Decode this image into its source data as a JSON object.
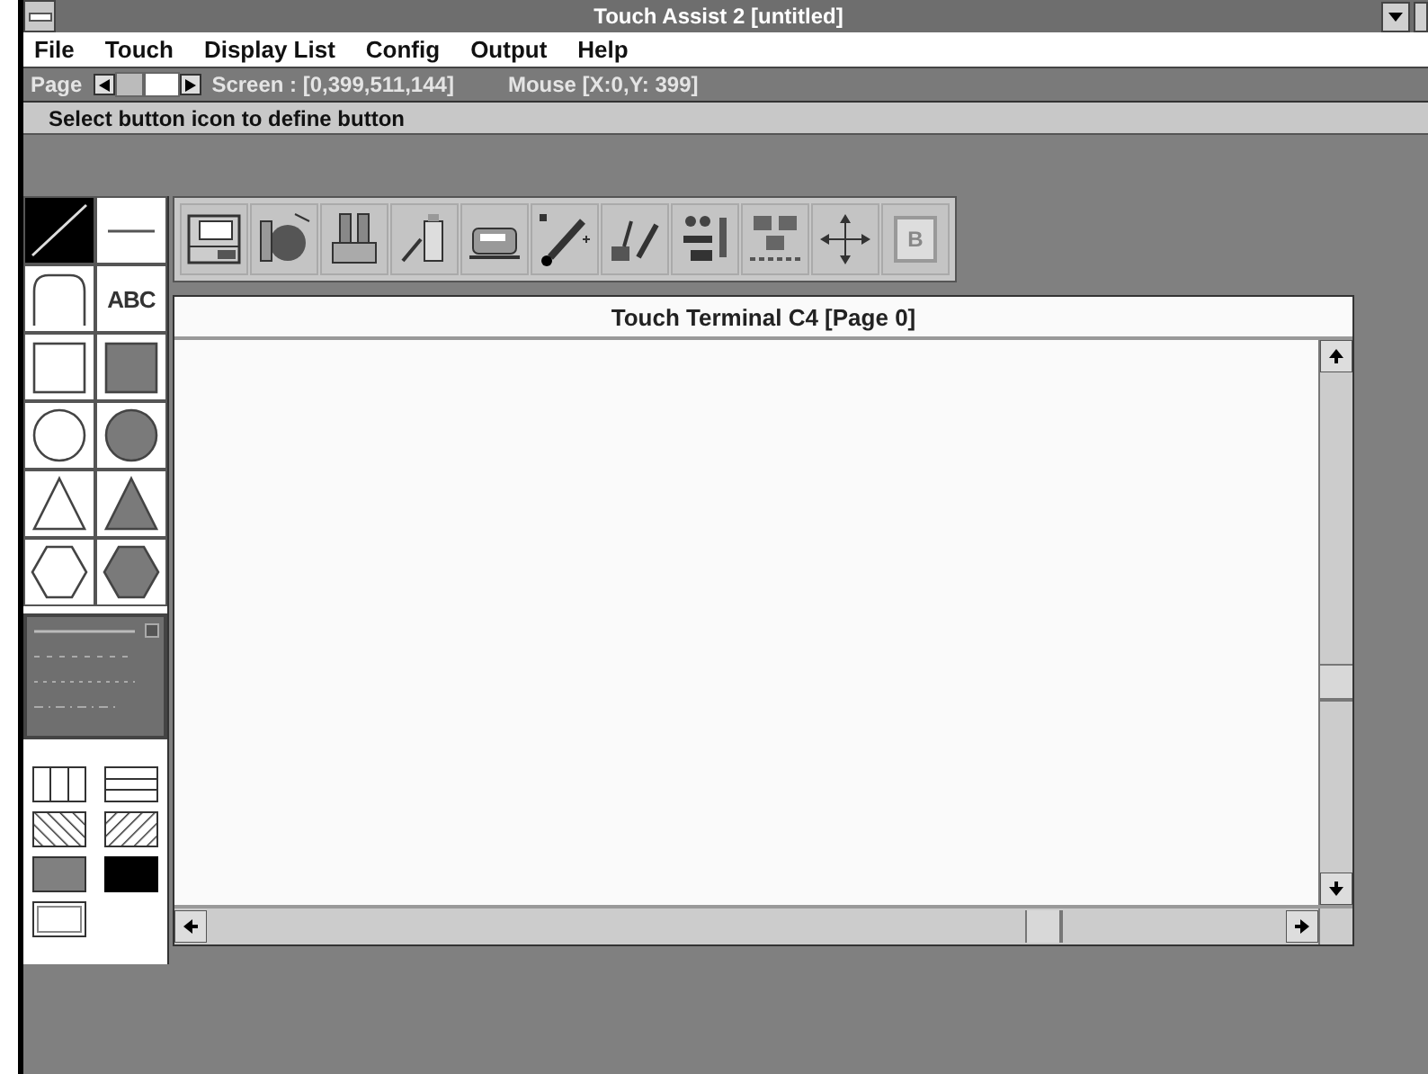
{
  "window": {
    "title": "Touch Assist 2 [untitled]"
  },
  "menu": [
    "File",
    "Touch",
    "Display List",
    "Config",
    "Output",
    "Help"
  ],
  "info_bar": {
    "page_label": "Page",
    "screen": "Screen : [0,399,511,144]",
    "mouse": "Mouse [X:0,Y: 399]"
  },
  "prompt": "Select button icon to define button",
  "palette": {
    "tools": [
      {
        "kind": "diagonal-line",
        "selected": true
      },
      {
        "kind": "horizontal-line",
        "selected": false
      },
      {
        "kind": "arch",
        "selected": false
      },
      {
        "kind": "text",
        "label": "ABC",
        "selected": false
      },
      {
        "kind": "square",
        "selected": false
      },
      {
        "kind": "square-filled",
        "selected": false
      },
      {
        "kind": "circle",
        "selected": false
      },
      {
        "kind": "circle-filled",
        "selected": false
      },
      {
        "kind": "triangle",
        "selected": false
      },
      {
        "kind": "triangle-filled",
        "selected": false
      },
      {
        "kind": "hexagon",
        "selected": false
      },
      {
        "kind": "hexagon-filled",
        "selected": false
      }
    ],
    "patterns": [
      {
        "kind": "vertical-bars"
      },
      {
        "kind": "horizontal-bars"
      },
      {
        "kind": "hatch-down"
      },
      {
        "kind": "hatch-up"
      },
      {
        "kind": "grey"
      },
      {
        "kind": "black"
      },
      {
        "kind": "frame"
      }
    ]
  },
  "toolbar": [
    {
      "kind": "layout"
    },
    {
      "kind": "bucket"
    },
    {
      "kind": "cylinders"
    },
    {
      "kind": "bottle"
    },
    {
      "kind": "machine"
    },
    {
      "kind": "pencil"
    },
    {
      "kind": "figures"
    },
    {
      "kind": "people"
    },
    {
      "kind": "tree"
    },
    {
      "kind": "move"
    },
    {
      "kind": "letter",
      "label": "B"
    }
  ],
  "document": {
    "title": "Touch Terminal C4 [Page 0]"
  }
}
